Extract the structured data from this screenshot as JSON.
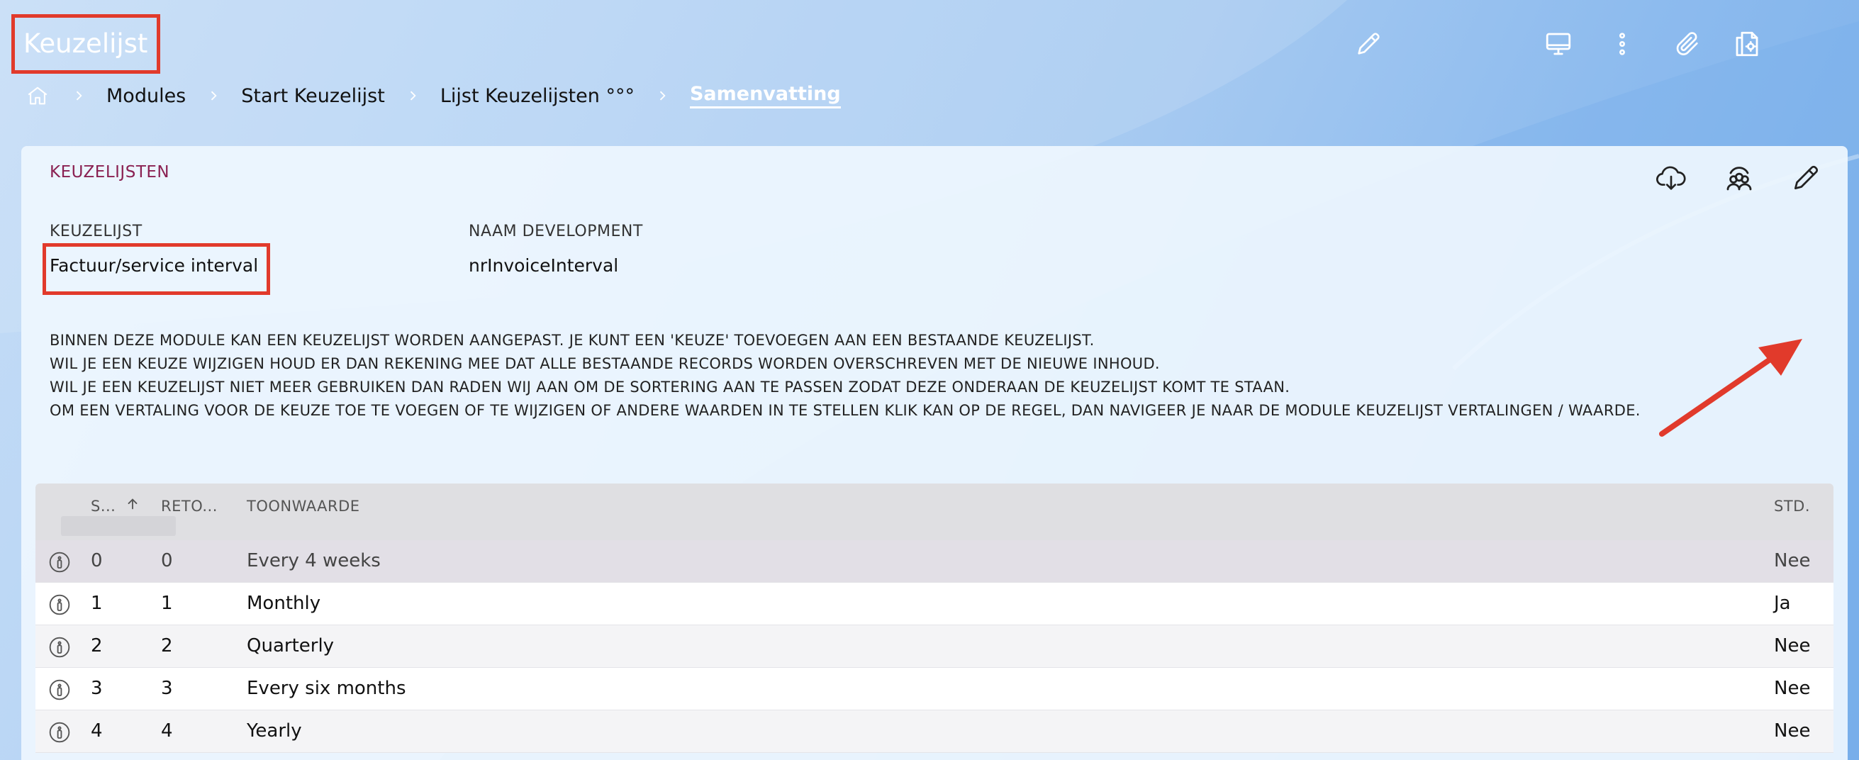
{
  "app": {
    "title": "Keuzelijst"
  },
  "top_icons": [
    "pencil-icon",
    "monitor-icon",
    "more-vertical-icon",
    "paperclip-icon",
    "document-settings-icon"
  ],
  "breadcrumb": {
    "home_icon": "home-icon",
    "items": [
      "Modules",
      "Start Keuzelijst",
      "Lijst Keuzelijsten °°°",
      "Samenvatting"
    ]
  },
  "panel": {
    "heading": "KEUZELIJSTEN",
    "icons": [
      "cloud-download-icon",
      "users-icon",
      "pencil-icon"
    ],
    "fields": {
      "keuzelijst_label": "KEUZELIJST",
      "keuzelijst_value": "Factuur/service interval",
      "naam_label": "NAAM DEVELOPMENT",
      "naam_value": "nrInvoiceInterval"
    },
    "description": [
      "BINNEN DEZE MODULE KAN EEN KEUZELIJST WORDEN AANGEPAST. JE KUNT EEN 'KEUZE' TOEVOEGEN AAN EEN BESTAANDE KEUZELIJST.",
      "WIL JE EEN KEUZE WIJZIGEN HOUD ER DAN REKENING MEE DAT ALLE BESTAANDE RECORDS WORDEN OVERSCHREVEN MET DE NIEUWE INHOUD.",
      "WIL JE EEN KEUZELIJST NIET MEER GEBRUIKEN DAN RADEN WIJ AAN OM DE SORTERING AAN TE PASSEN ZODAT DEZE ONDERAAN DE KEUZELIJST KOMT TE STAAN.",
      "OM EEN VERTALING VOOR DE KEUZE TOE TE VOEGEN OF TE WIJZIGEN OF ANDERE WAARDEN IN TE STELLEN KLIK KAN OP DE REGEL, DAN NAVIGEER JE NAAR DE MODULE KEUZELIJST VERTALINGEN / WAARDE."
    ]
  },
  "table": {
    "columns": {
      "sort": "S...",
      "return": "RETO...",
      "display": "TOONWAARDE",
      "std": "STD."
    },
    "rows": [
      {
        "sort": "0",
        "return": "0",
        "display": "Every 4 weeks",
        "std": "Nee"
      },
      {
        "sort": "1",
        "return": "1",
        "display": "Monthly",
        "std": "Ja"
      },
      {
        "sort": "2",
        "return": "2",
        "display": "Quarterly",
        "std": "Nee"
      },
      {
        "sort": "3",
        "return": "3",
        "display": "Every six months",
        "std": "Nee"
      },
      {
        "sort": "4",
        "return": "4",
        "display": "Yearly",
        "std": "Nee"
      }
    ]
  },
  "colors": {
    "highlight": "#e13a2b",
    "heading": "#8a2152",
    "accent_white": "#ffffff"
  }
}
